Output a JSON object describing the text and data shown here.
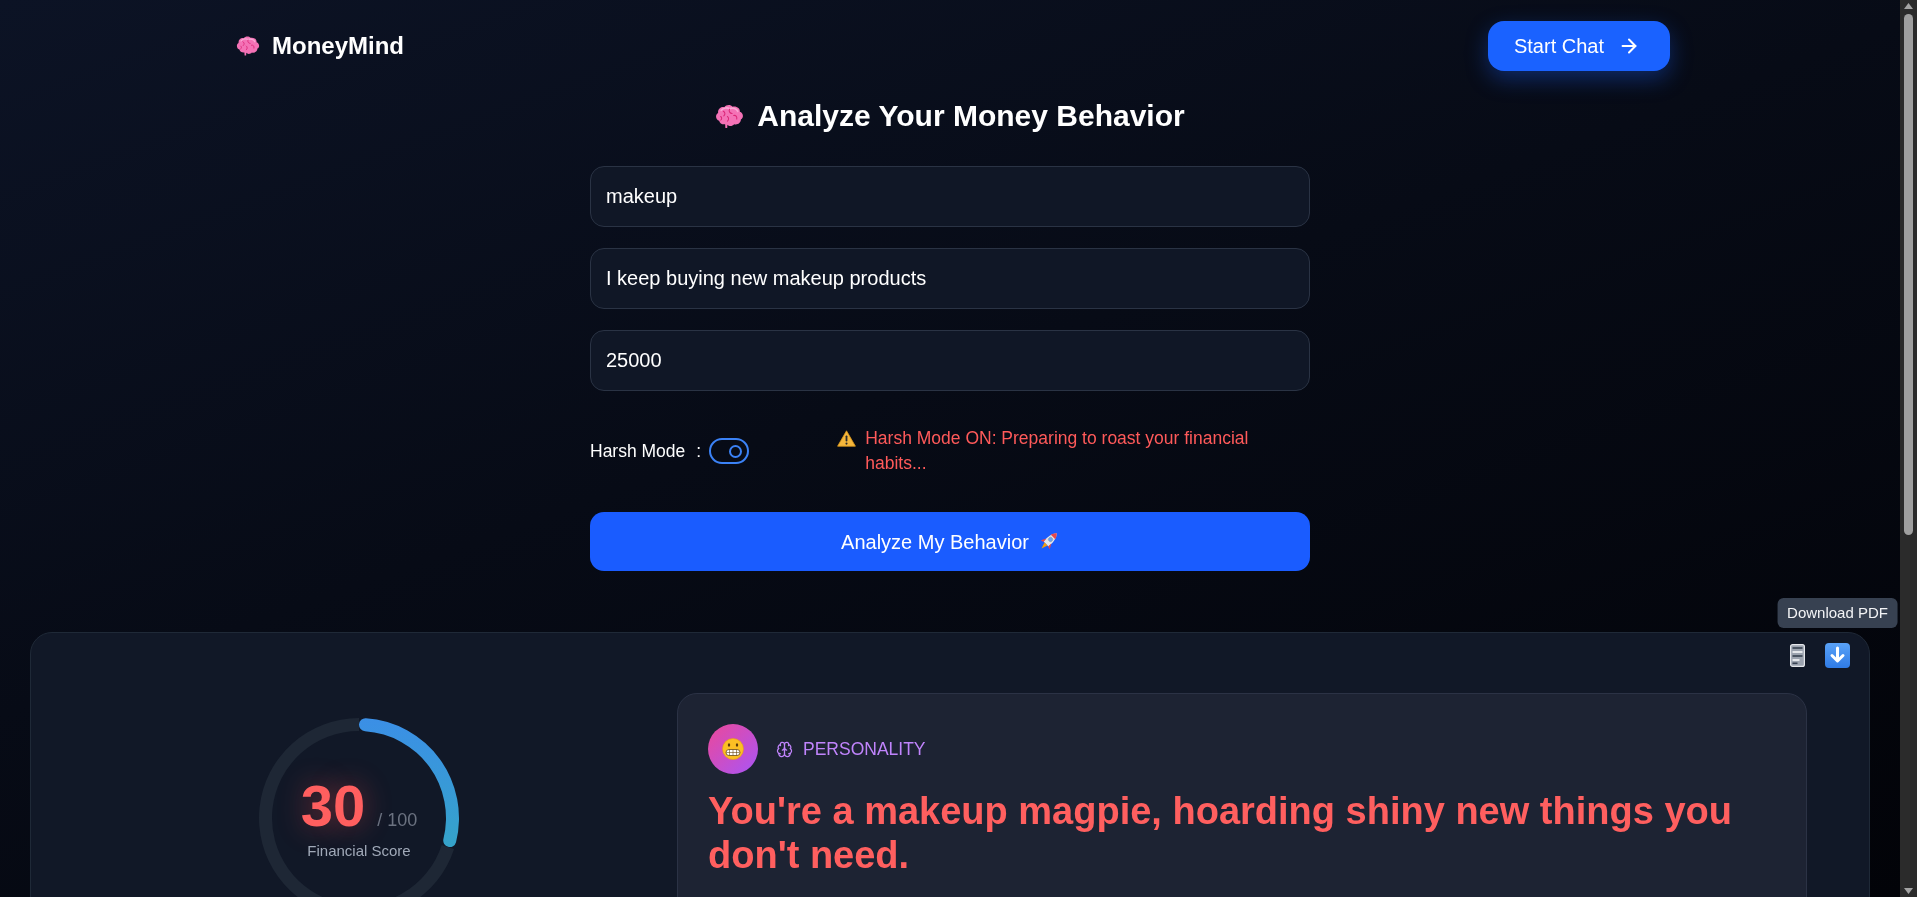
{
  "header": {
    "brand": "MoneyMind",
    "start_chat": "Start Chat"
  },
  "analyzer": {
    "title": "Analyze Your Money Behavior",
    "fields": [
      {
        "value": "makeup"
      },
      {
        "value": "I keep buying new makeup products"
      },
      {
        "value": "25000"
      }
    ],
    "harsh_mode": {
      "label": "Harsh Mode",
      "separator": ":",
      "on": true,
      "warning": "Harsh Mode ON: Preparing to roast your financial habits..."
    },
    "submit": "Analyze My Behavior"
  },
  "report": {
    "tooltip": "Download PDF",
    "score": {
      "value": "30",
      "max": "/ 100",
      "label": "Financial Score",
      "chart_data": {
        "type": "donut",
        "values": [
          30,
          70
        ]
      }
    },
    "personality": {
      "label": "PERSONALITY",
      "headline": "You're a makeup magpie, hoarding shiny new things you don't need."
    }
  }
}
